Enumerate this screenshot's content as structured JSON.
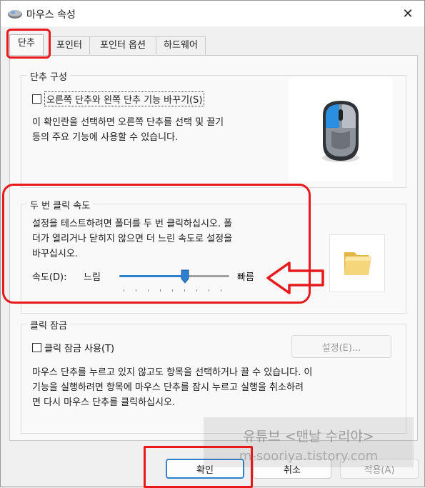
{
  "window": {
    "title": "마우스 속성",
    "close_glyph": "✕",
    "icon": "mouse-icon"
  },
  "tabs": [
    {
      "label": "단추",
      "active": true
    },
    {
      "label": "포인터",
      "active": false
    },
    {
      "label": "포인터 옵션",
      "active": false
    },
    {
      "label": "하드웨어",
      "active": false
    }
  ],
  "button_config": {
    "legend": "단추 구성",
    "checkbox_label": "오른쪽 단추와 왼쪽 단추 기능 바꾸기(S)",
    "checked": false,
    "description_line1": "이 확인란을 선택하면 오른쪽 단추를 선택 및 끌기",
    "description_line2": "등의 주요 기능에 사용할 수 있습니다."
  },
  "double_click": {
    "legend": "두 번 클릭 속도",
    "description_line1": "설정을 테스트하려면 폴더를 두 번 클릭하십시오. 폴",
    "description_line2": "더가 열리거나 닫히지 않으면 더 느린 속도로 설정을",
    "description_line3": "바꾸십시오.",
    "speed_label": "속도(D):",
    "slow_label": "느림",
    "fast_label": "빠름",
    "speed_value": 0.6
  },
  "click_lock": {
    "legend": "클릭 잠금",
    "checkbox_label": "클릭 잠금 사용(T)",
    "checked": false,
    "settings_button": "설정(E)...",
    "description_line1": "마우스 단추를 누르고 있지 않고도 항목을 선택하거나 끌 수 있습니다. 이",
    "description_line2": "기능을 실행하려면 항목에 마우스 단추를 잠시 누르고 실행을 취소하려",
    "description_line3": "면 다시 마우스 단추를 클릭하십시오."
  },
  "footer": {
    "ok": "확인",
    "cancel": "취소",
    "apply": "적용(A)"
  },
  "watermark": {
    "line1": "유튜브 <맨날 수리야>",
    "line2": "m-sooriya.tistory.com"
  },
  "annotation_color": "#e8191b",
  "accent_color": "#2d7fd0"
}
